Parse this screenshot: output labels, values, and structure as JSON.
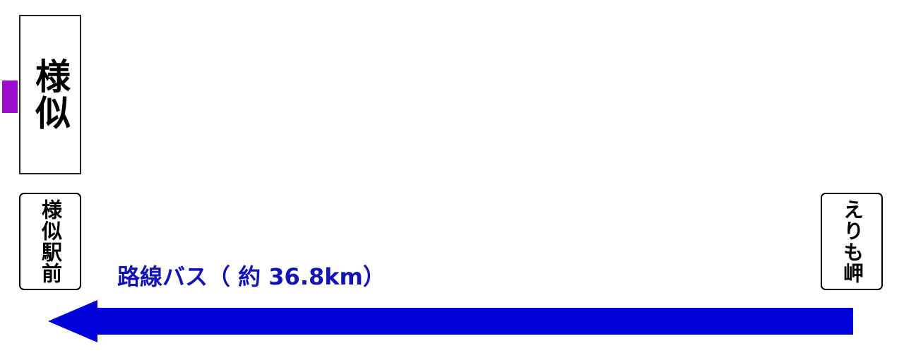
{
  "colors": {
    "accent": "#9b0fcc",
    "route": "#0000d8",
    "route_label": "#1414b4"
  },
  "station": {
    "name": "様似"
  },
  "stops": {
    "origin": "様似駅前",
    "destination": "えりも岬"
  },
  "route": {
    "label": "路線バス（ 約 36.8km）",
    "direction": "left"
  }
}
